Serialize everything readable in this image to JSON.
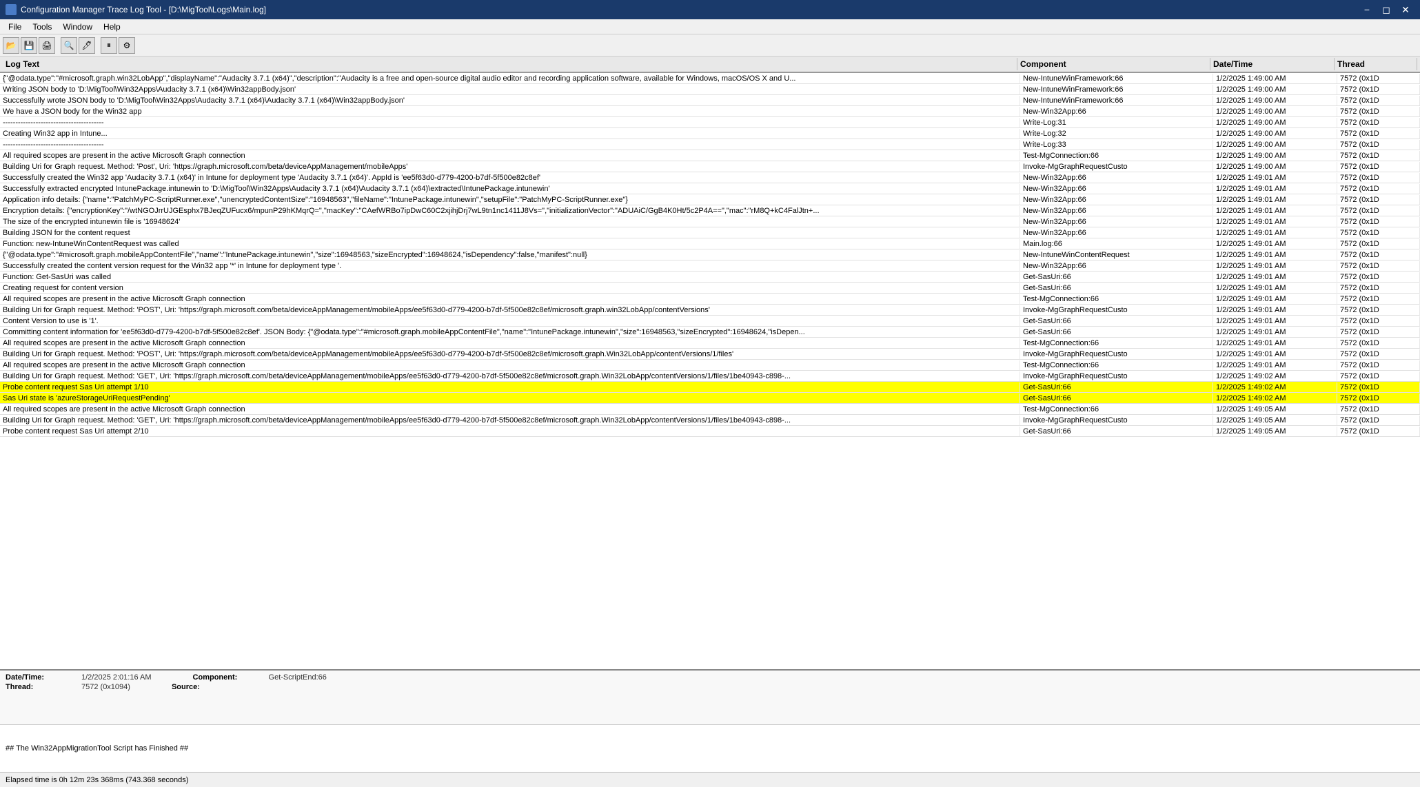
{
  "titleBar": {
    "title": "Configuration Manager Trace Log Tool - [D:\\MigTool\\Logs\\Main.log]",
    "iconLabel": "CMTrace",
    "controls": [
      "minimize",
      "maximize",
      "close"
    ]
  },
  "menuBar": {
    "items": [
      "File",
      "Tools",
      "Window",
      "Help"
    ]
  },
  "toolbar": {
    "buttons": [
      "open",
      "save",
      "print",
      "find",
      "highlight",
      "pause",
      "settings"
    ]
  },
  "logTable": {
    "headers": [
      "Log Text",
      "Component",
      "Date/Time",
      "Thread"
    ],
    "rows": [
      {
        "text": "{\"@odata.type\":\"#microsoft.graph.win32LobApp\",\"displayName\":\"Audacity 3.7.1 (x64)\",\"description\":\"Audacity is a free and open-source digital audio editor and recording application software, available for Windows, macOS/OS X and U...",
        "component": "New-IntuneWinFramework:66",
        "datetime": "1/2/2025 1:49:00 AM",
        "thread": "7572 (0x1D",
        "highlighted": false
      },
      {
        "text": "Writing JSON body to 'D:\\MigTool\\Win32Apps\\Audacity 3.7.1 (x64)\\Win32appBody.json'",
        "component": "New-IntuneWinFramework:66",
        "datetime": "1/2/2025 1:49:00 AM",
        "thread": "7572 (0x1D",
        "highlighted": false
      },
      {
        "text": "Successfully wrote JSON body to 'D:\\MigTool\\Win32Apps\\Audacity 3.7.1 (x64)\\Audacity 3.7.1 (x64)\\Win32appBody.json'",
        "component": "New-IntuneWinFramework:66",
        "datetime": "1/2/2025 1:49:00 AM",
        "thread": "7572 (0x1D",
        "highlighted": false
      },
      {
        "text": "We have a JSON body for the Win32 app",
        "component": "New-Win32App:66",
        "datetime": "1/2/2025 1:49:00 AM",
        "thread": "7572 (0x1D",
        "highlighted": false
      },
      {
        "text": "----------------------------------------",
        "component": "Write-Log:31",
        "datetime": "1/2/2025 1:49:00 AM",
        "thread": "7572 (0x1D",
        "highlighted": false
      },
      {
        "text": "Creating Win32 app in Intune...",
        "component": "Write-Log:32",
        "datetime": "1/2/2025 1:49:00 AM",
        "thread": "7572 (0x1D",
        "highlighted": false
      },
      {
        "text": "----------------------------------------",
        "component": "Write-Log:33",
        "datetime": "1/2/2025 1:49:00 AM",
        "thread": "7572 (0x1D",
        "highlighted": false
      },
      {
        "text": "All required scopes are present in the active Microsoft Graph connection",
        "component": "Test-MgConnection:66",
        "datetime": "1/2/2025 1:49:00 AM",
        "thread": "7572 (0x1D",
        "highlighted": false
      },
      {
        "text": "Building Uri for Graph request. Method: 'Post', Uri: 'https://graph.microsoft.com/beta/deviceAppManagement/mobileApps'",
        "component": "Invoke-MgGraphRequestCusto",
        "datetime": "1/2/2025 1:49:00 AM",
        "thread": "7572 (0x1D",
        "highlighted": false
      },
      {
        "text": "Successfully created the Win32 app 'Audacity 3.7.1 (x64)' in Intune for deployment type 'Audacity 3.7.1 (x64)'. AppId is 'ee5f63d0-d779-4200-b7df-5f500e82c8ef'",
        "component": "New-Win32App:66",
        "datetime": "1/2/2025 1:49:01 AM",
        "thread": "7572 (0x1D",
        "highlighted": false
      },
      {
        "text": "Successfully extracted encrypted IntunePackage.intunewin to 'D:\\MigTool\\Win32Apps\\Audacity 3.7.1 (x64)\\Audacity 3.7.1 (x64)\\extracted\\IntunePackage.intunewin'",
        "component": "New-Win32App:66",
        "datetime": "1/2/2025 1:49:01 AM",
        "thread": "7572 (0x1D",
        "highlighted": false
      },
      {
        "text": "Application info details: {\"name\":\"PatchMyPC-ScriptRunner.exe\",\"unencryptedContentSize\":\"16948563\",\"fileName\":\"IntunePackage.intunewin\",\"setupFile\":\"PatchMyPC-ScriptRunner.exe\"}",
        "component": "New-Win32App:66",
        "datetime": "1/2/2025 1:49:01 AM",
        "thread": "7572 (0x1D",
        "highlighted": false
      },
      {
        "text": "Encryption details: {\"encryptionKey\":\"/wtNGOJrrUJGEsphx7BJeqZUFucx6/mpunP29hKMqrQ=\",\"macKey\":\"CAefWRBo7ipDwC60C2xjihjDrj7wL9tn1nc1411J8Vs=\",\"initializationVector\":\"ADUAiC/GgB4K0Ht/5c2P4A==\",\"mac\":\"rM8Q+kC4FalJtn+...",
        "component": "New-Win32App:66",
        "datetime": "1/2/2025 1:49:01 AM",
        "thread": "7572 (0x1D",
        "highlighted": false
      },
      {
        "text": "The size of the encrypted intunewin file is '16948624'",
        "component": "New-Win32App:66",
        "datetime": "1/2/2025 1:49:01 AM",
        "thread": "7572 (0x1D",
        "highlighted": false
      },
      {
        "text": "Building JSON for the content request",
        "component": "New-Win32App:66",
        "datetime": "1/2/2025 1:49:01 AM",
        "thread": "7572 (0x1D",
        "highlighted": false
      },
      {
        "text": "Function: new-IntuneWinContentRequest was called",
        "component": "Main.log:66",
        "datetime": "1/2/2025 1:49:01 AM",
        "thread": "7572 (0x1D",
        "highlighted": false
      },
      {
        "text": "{\"@odata.type\":\"#microsoft.graph.mobileAppContentFile\",\"name\":\"IntunePackage.intunewin\",\"size\":16948563,\"sizeEncrypted\":16948624,\"isDependency\":false,\"manifest\":null}",
        "component": "New-IntuneWinContentRequest",
        "datetime": "1/2/2025 1:49:01 AM",
        "thread": "7572 (0x1D",
        "highlighted": false
      },
      {
        "text": "Successfully created the content version request for the Win32 app '*' in Intune for deployment type '.",
        "component": "New-Win32App:66",
        "datetime": "1/2/2025 1:49:01 AM",
        "thread": "7572 (0x1D",
        "highlighted": false
      },
      {
        "text": "Function: Get-SasUri was called",
        "component": "Get-SasUri:66",
        "datetime": "1/2/2025 1:49:01 AM",
        "thread": "7572 (0x1D",
        "highlighted": false
      },
      {
        "text": "Creating request for content version",
        "component": "Get-SasUri:66",
        "datetime": "1/2/2025 1:49:01 AM",
        "thread": "7572 (0x1D",
        "highlighted": false
      },
      {
        "text": "All required scopes are present in the active Microsoft Graph connection",
        "component": "Test-MgConnection:66",
        "datetime": "1/2/2025 1:49:01 AM",
        "thread": "7572 (0x1D",
        "highlighted": false
      },
      {
        "text": "Building Uri for Graph request. Method: 'POST', Uri: 'https://graph.microsoft.com/beta/deviceAppManagement/mobileApps/ee5f63d0-d779-4200-b7df-5f500e82c8ef/microsoft.graph.win32LobApp/contentVersions'",
        "component": "Invoke-MgGraphRequestCusto",
        "datetime": "1/2/2025 1:49:01 AM",
        "thread": "7572 (0x1D",
        "highlighted": false
      },
      {
        "text": "Content Version to use is '1'.",
        "component": "Get-SasUri:66",
        "datetime": "1/2/2025 1:49:01 AM",
        "thread": "7572 (0x1D",
        "highlighted": false
      },
      {
        "text": "Committing content information for 'ee5f63d0-d779-4200-b7df-5f500e82c8ef'. JSON Body: {\"@odata.type\":\"#microsoft.graph.mobileAppContentFile\",\"name\":\"IntunePackage.intunewin\",\"size\":16948563,\"sizeEncrypted\":16948624,\"isDepen...",
        "component": "Get-SasUri:66",
        "datetime": "1/2/2025 1:49:01 AM",
        "thread": "7572 (0x1D",
        "highlighted": false
      },
      {
        "text": "All required scopes are present in the active Microsoft Graph connection",
        "component": "Test-MgConnection:66",
        "datetime": "1/2/2025 1:49:01 AM",
        "thread": "7572 (0x1D",
        "highlighted": false
      },
      {
        "text": "Building Uri for Graph request. Method: 'POST', Uri: 'https://graph.microsoft.com/beta/deviceAppManagement/mobileApps/ee5f63d0-d779-4200-b7df-5f500e82c8ef/microsoft.graph.Win32LobApp/contentVersions/1/files'",
        "component": "Invoke-MgGraphRequestCusto",
        "datetime": "1/2/2025 1:49:01 AM",
        "thread": "7572 (0x1D",
        "highlighted": false
      },
      {
        "text": "All required scopes are present in the active Microsoft Graph connection",
        "component": "Test-MgConnection:66",
        "datetime": "1/2/2025 1:49:01 AM",
        "thread": "7572 (0x1D",
        "highlighted": false
      },
      {
        "text": "Building Uri for Graph request. Method: 'GET', Uri: 'https://graph.microsoft.com/beta/deviceAppManagement/mobileApps/ee5f63d0-d779-4200-b7df-5f500e82c8ef/microsoft.graph.Win32LobApp/contentVersions/1/files/1be40943-c898-...",
        "component": "Invoke-MgGraphRequestCusto",
        "datetime": "1/2/2025 1:49:02 AM",
        "thread": "7572 (0x1D",
        "highlighted": false
      },
      {
        "text": "Probe content request Sas Uri attempt 1/10",
        "component": "Get-SasUri:66",
        "datetime": "1/2/2025 1:49:02 AM",
        "thread": "7572 (0x1D",
        "highlighted": true
      },
      {
        "text": "Sas Uri state is 'azureStorageUriRequestPending'",
        "component": "Get-SasUri:66",
        "datetime": "1/2/2025 1:49:02 AM",
        "thread": "7572 (0x1D",
        "highlighted": true
      },
      {
        "text": "All required scopes are present in the active Microsoft Graph connection",
        "component": "Test-MgConnection:66",
        "datetime": "1/2/2025 1:49:05 AM",
        "thread": "7572 (0x1D",
        "highlighted": false
      },
      {
        "text": "Building Uri for Graph request. Method: 'GET', Uri: 'https://graph.microsoft.com/beta/deviceAppManagement/mobileApps/ee5f63d0-d779-4200-b7df-5f500e82c8ef/microsoft.graph.Win32LobApp/contentVersions/1/files/1be40943-c898-...",
        "component": "Invoke-MgGraphRequestCusto",
        "datetime": "1/2/2025 1:49:05 AM",
        "thread": "7572 (0x1D",
        "highlighted": false
      },
      {
        "text": "Probe content request Sas Uri attempt 2/10",
        "component": "Get-SasUri:66",
        "datetime": "1/2/2025 1:49:05 AM",
        "thread": "7572 (0x1D",
        "highlighted": false
      }
    ]
  },
  "detailPane": {
    "datetime_label": "Date/Time:",
    "datetime_value": "1/2/2025 2:01:16 AM",
    "component_label": "Component:",
    "component_value": "Get-ScriptEnd:66",
    "thread_label": "Thread:",
    "thread_value": "7572 (0x1094)",
    "source_label": "Source:",
    "source_value": ""
  },
  "messageArea": {
    "content": "## The Win32AppMigrationTool Script has Finished ##"
  },
  "statusBar": {
    "text": "Elapsed time is 0h 12m 23s 368ms (743.368 seconds)"
  }
}
